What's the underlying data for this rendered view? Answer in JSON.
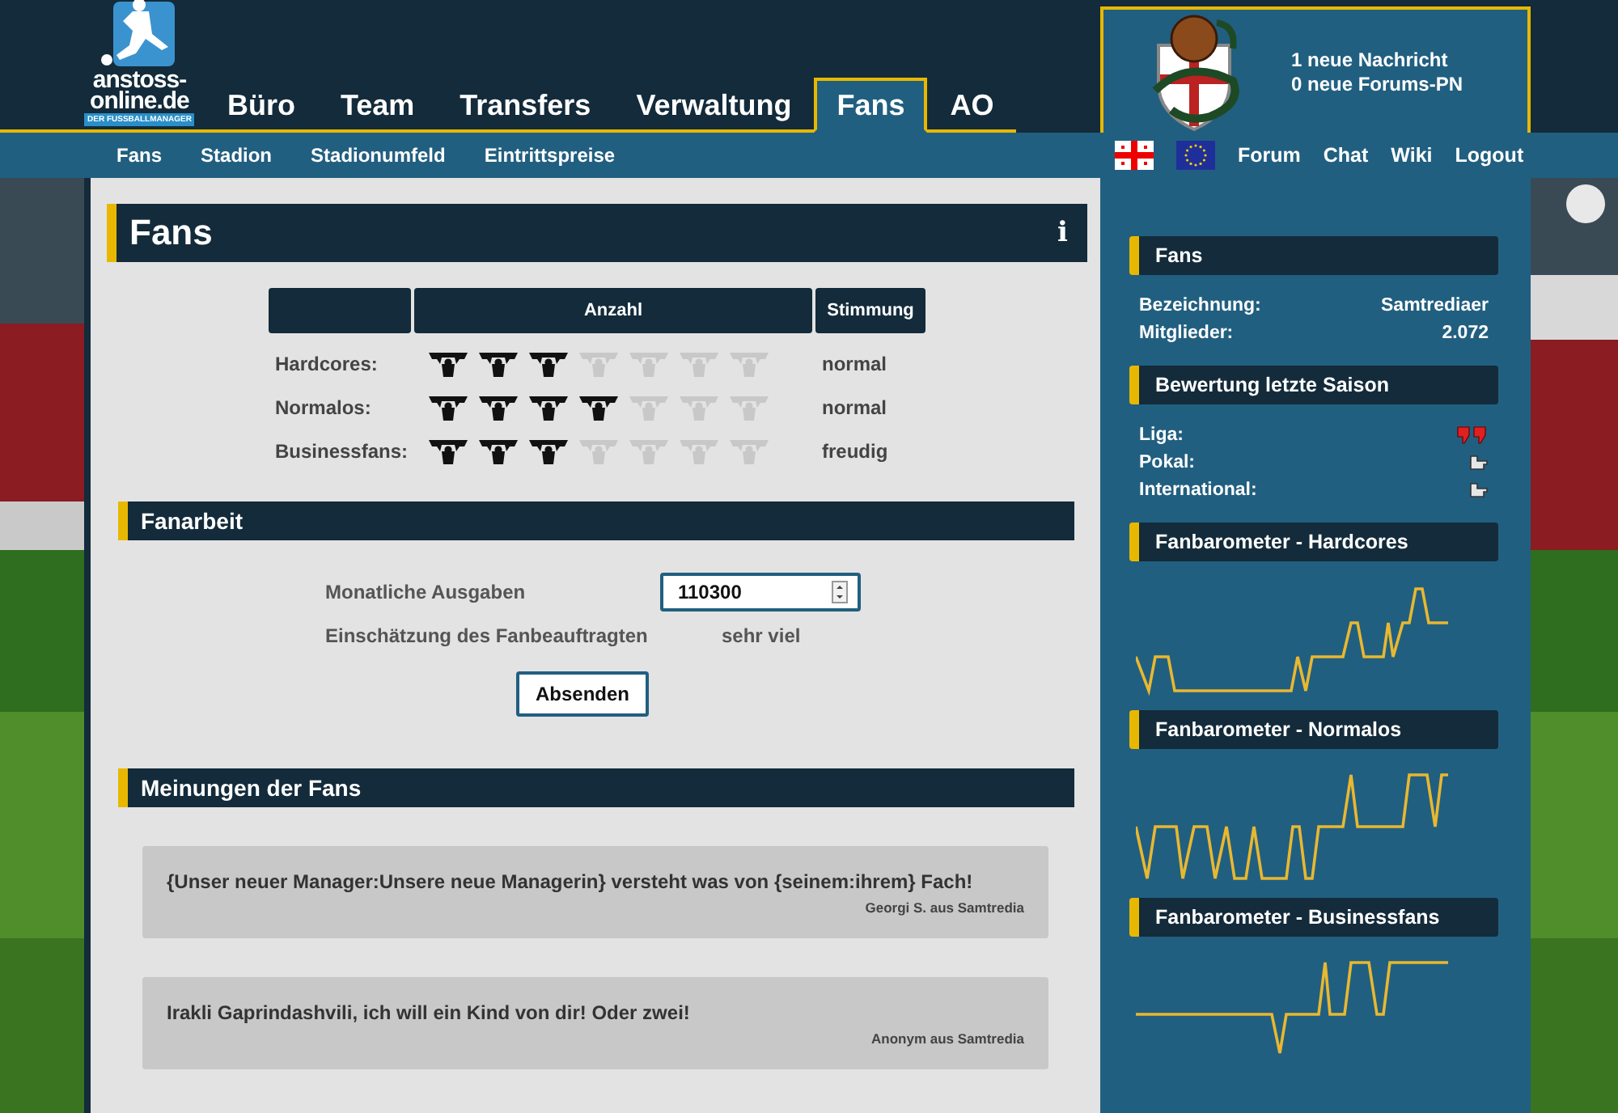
{
  "logo": {
    "line1": "anstoss-",
    "line2": "online.de",
    "tagline": "DER FUSSBALLMANAGER"
  },
  "nav": [
    {
      "label": "Büro",
      "selected": false
    },
    {
      "label": "Team",
      "selected": false
    },
    {
      "label": "Transfers",
      "selected": false
    },
    {
      "label": "Verwaltung",
      "selected": false
    },
    {
      "label": "Fans",
      "selected": true
    },
    {
      "label": "AO",
      "selected": false
    }
  ],
  "user_box": {
    "messages": [
      "1 neue Nachricht",
      "0 neue Forums-PN"
    ]
  },
  "subnav": [
    "Fans",
    "Stadion",
    "Stadionumfeld",
    "Eintrittspreise"
  ],
  "top_links": [
    "Forum",
    "Chat",
    "Wiki",
    "Logout"
  ],
  "page": {
    "title": "Fans",
    "info": "i"
  },
  "fan_table": {
    "columns": [
      "Anzahl",
      "Stimmung"
    ],
    "rows": [
      {
        "label": "Hardcores:",
        "stars": 3,
        "mood": "normal"
      },
      {
        "label": "Normalos:",
        "stars": 4,
        "mood": "normal"
      },
      {
        "label": "Businessfans:",
        "stars": 3,
        "mood": "freudig"
      }
    ]
  },
  "fanarbeit": {
    "title": "Fanarbeit",
    "fields": [
      {
        "kind": "input",
        "label": "Monatliche Ausgaben",
        "value": "110300"
      },
      {
        "kind": "text",
        "label": "Einschätzung des Fanbeauftragten",
        "value": "sehr viel"
      }
    ],
    "button": "Absenden"
  },
  "opinions": {
    "title": "Meinungen der Fans",
    "items": [
      {
        "text": "{Unser neuer Manager:Unsere neue Managerin} versteht was von {seinem:ihrem} Fach!",
        "author": "Georgi S. aus Samtredia"
      },
      {
        "text": "Irakli Gaprindashvili, ich will ein Kind von dir! Oder zwei!",
        "author": "Anonym aus Samtredia"
      }
    ]
  },
  "sidebar": {
    "fans": {
      "title": "Fans",
      "rows": [
        {
          "label": "Bezeichnung:",
          "value": "Samtrediaer"
        },
        {
          "label": "Mitglieder:",
          "value": "2.072"
        }
      ]
    },
    "rating": {
      "title": "Bewertung letzte Saison",
      "rows": [
        {
          "label": "Liga:",
          "kind": "very_bad"
        },
        {
          "label": "Pokal:",
          "kind": "neutral"
        },
        {
          "label": "International:",
          "kind": "neutral"
        }
      ]
    },
    "barometers": [
      {
        "title": "Fanbarometer - Hardcores"
      },
      {
        "title": "Fanbarometer - Normalos"
      },
      {
        "title": "Fanbarometer - Businessfans"
      }
    ]
  }
}
